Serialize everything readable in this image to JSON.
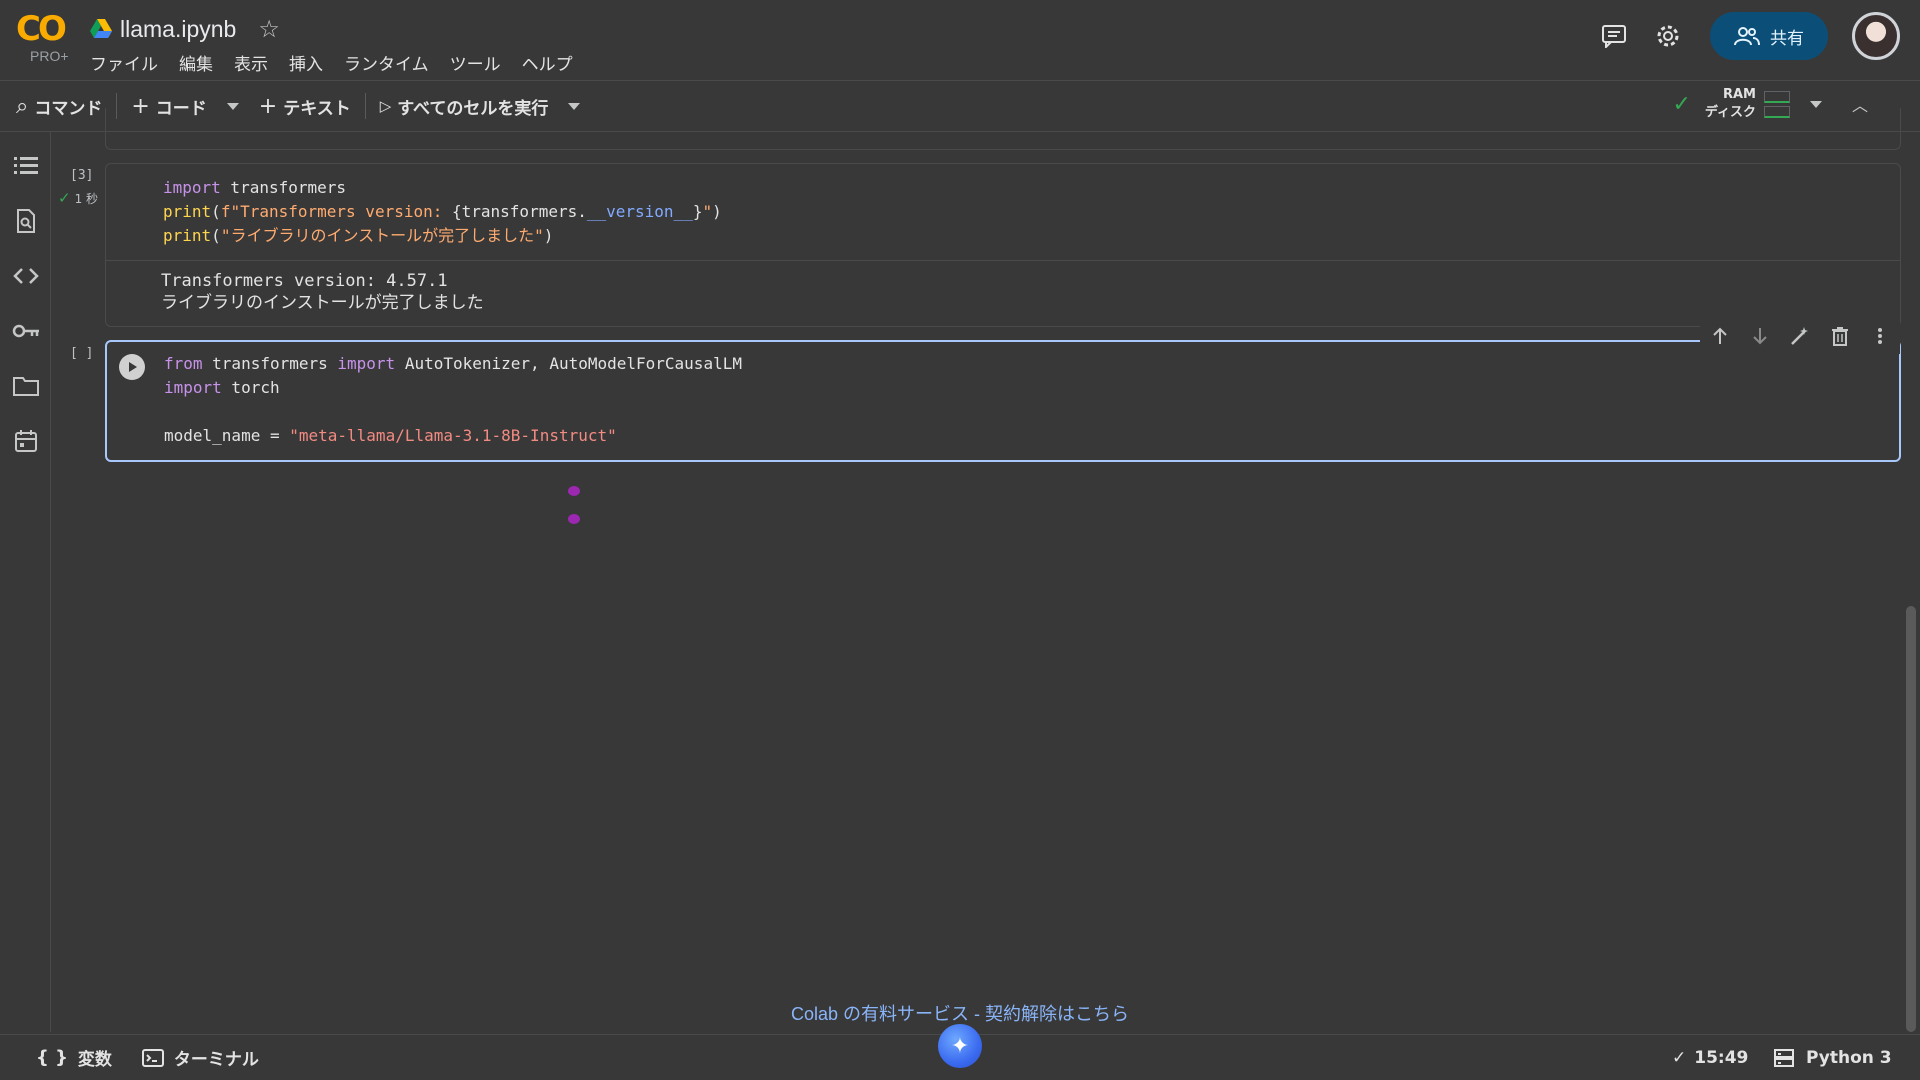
{
  "app": {
    "logo_text": "CO",
    "plan": "PRO+",
    "notebook_title": "llama.ipynb"
  },
  "menu": [
    "ファイル",
    "編集",
    "表示",
    "挿入",
    "ランタイム",
    "ツール",
    "ヘルプ"
  ],
  "header": {
    "share_label": "共有"
  },
  "toolbar": {
    "command_label": "コマンド",
    "add_code_label": "コード",
    "add_text_label": "テキスト",
    "run_all_label": "すべてのセルを実行",
    "ram_label": "RAM",
    "disk_label": "ディスク"
  },
  "cells": [
    {
      "exec_count": "[3]",
      "exec_time": "1 秒",
      "code_lines": [
        "import transformers",
        "print(f\"Transformers version: {transformers.__version__}\")",
        "print(\"ライブラリのインストールが完了しました\")"
      ],
      "output_lines": [
        "Transformers version: 4.57.1",
        "ライブラリのインストールが完了しました"
      ]
    },
    {
      "exec_count": "[ ]",
      "code_lines": [
        "from transformers import AutoTokenizer, AutoModelForCausalLM",
        "import torch",
        "",
        "model_name = \"meta-llama/Llama-3.1-8B-Instruct\""
      ]
    }
  ],
  "footer": {
    "promo_text": "Colab の有料サービス  -  契約解除はこちら",
    "variables_label": "変数",
    "terminal_label": "ターミナル",
    "time": "15:49",
    "runtime": "Python 3"
  },
  "colors": {
    "accent": "#a8c7fa",
    "share_bg": "#0b4f79",
    "logo": "#f9ab00",
    "ok": "#34a853"
  }
}
